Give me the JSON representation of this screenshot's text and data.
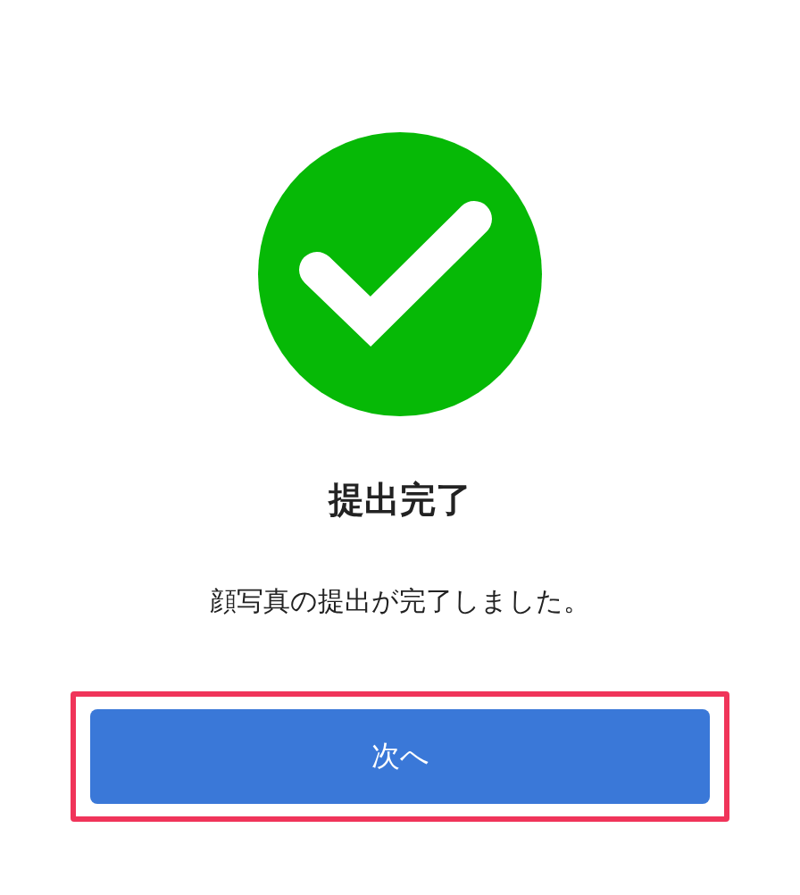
{
  "status": {
    "kind": "success"
  },
  "title": "提出完了",
  "message": "顔写真の提出が完了しました。",
  "button": {
    "label": "次へ",
    "highlighted": true
  }
}
